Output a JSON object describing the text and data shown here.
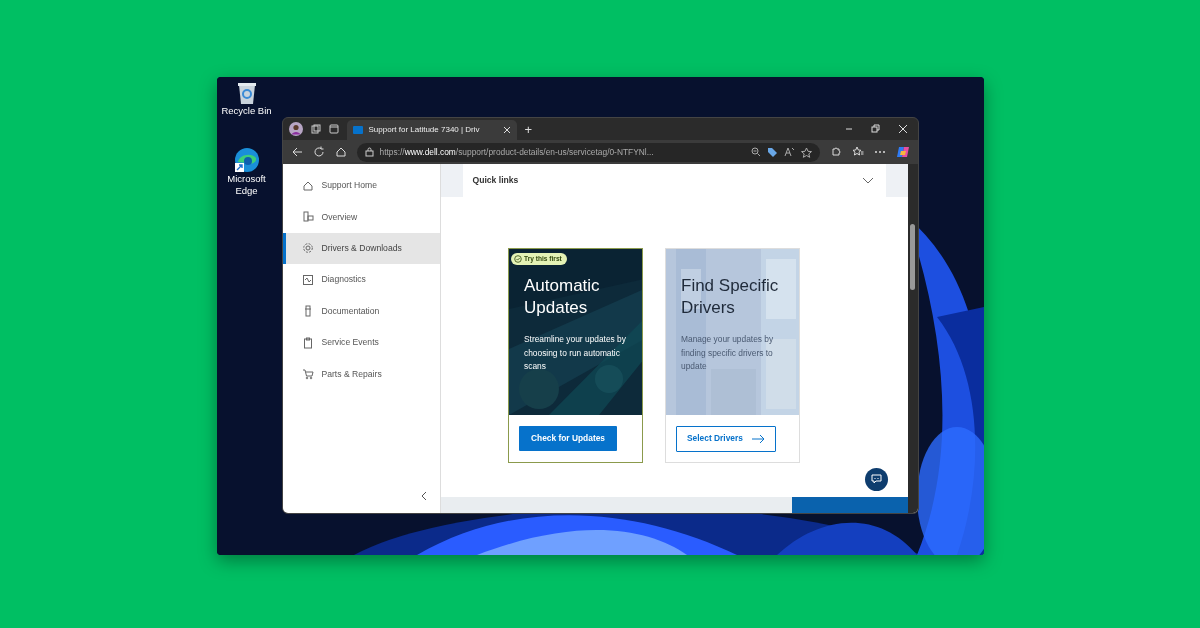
{
  "desktop_icons": [
    {
      "label": "Recycle Bin",
      "kind": "bin"
    },
    {
      "label": "Microsoft Edge",
      "kind": "edge"
    }
  ],
  "browser": {
    "tabs": [
      {
        "title": "Support for Latitude 7340 | Driv",
        "selected": true
      }
    ],
    "new_tab": "+",
    "address": "https://**www.dell.com**/support/product-details/en-us/servicetag/0-NTFYNl..."
  },
  "sidebar": {
    "items": [
      {
        "label": "Support Home",
        "selected": false
      },
      {
        "label": "Overview",
        "selected": false
      },
      {
        "label": "Drivers & Downloads",
        "selected": true
      },
      {
        "label": "Diagnostics",
        "selected": false
      },
      {
        "label": "Documentation",
        "selected": false
      },
      {
        "label": "Service Events",
        "selected": false
      },
      {
        "label": "Parts & Repairs",
        "selected": false
      }
    ]
  },
  "quick_links": {
    "label": "Quick links",
    "expanded": false
  },
  "cards": [
    {
      "kind": "auto",
      "badge": "Try this first",
      "title": "Automatic Updates",
      "text": "Streamline your updates by choosing to run automatic scans",
      "button": "Check for Updates"
    },
    {
      "kind": "manual",
      "title": "Find Specific Drivers",
      "text": "Manage your updates by finding specific drivers to update",
      "button": "Select Drivers"
    }
  ]
}
